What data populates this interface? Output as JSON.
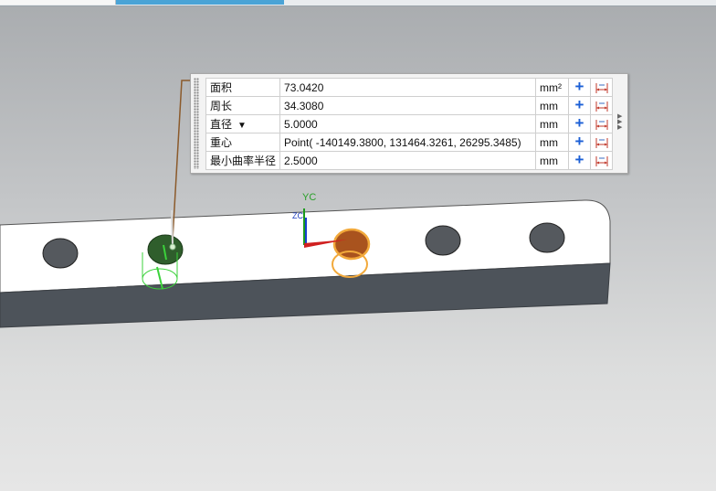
{
  "rows": [
    {
      "label": "面积",
      "value": "73.0420",
      "unit": "mm²"
    },
    {
      "label": "周长",
      "value": "34.3080",
      "unit": "mm"
    },
    {
      "label": "直径",
      "value": "5.0000",
      "unit": "mm",
      "dropdown": true
    },
    {
      "label": "重心",
      "value": "Point( -140149.3800, 131464.3261, 26295.3485)",
      "unit": "mm"
    },
    {
      "label": "最小曲率半径",
      "value": "2.5000",
      "unit": "mm"
    }
  ],
  "axis": {
    "y_label": "YC",
    "z_label": "ZC"
  },
  "icons": {
    "add": "plus-icon",
    "dimension": "dimension-icon",
    "expand": "expand-arrows-icon"
  },
  "colors": {
    "plus_blue": "#1b5fd6",
    "selected_hole_green": "#2f5e2c",
    "highlight_orange": "#f2a93b",
    "leader_brown": "#8b5a2b"
  }
}
